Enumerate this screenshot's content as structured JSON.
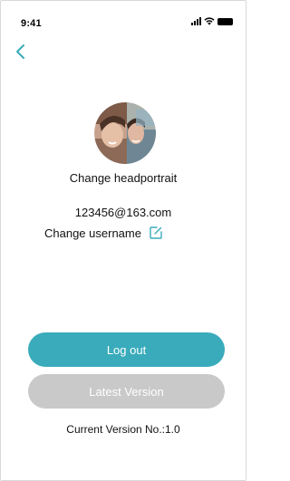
{
  "status_bar": {
    "time": "9:41",
    "icons": [
      "signal-icon",
      "wifi-icon",
      "battery-icon"
    ]
  },
  "nav": {
    "back_icon": "chevron-left-icon"
  },
  "profile": {
    "avatar_icon": "avatar-photo",
    "change_headportrait_label": "Change headportrait",
    "email": "123456@163.com",
    "change_username_label": "Change username",
    "edit_icon": "edit-icon"
  },
  "actions": {
    "logout_label": "Log out",
    "latest_version_label": "Latest Version"
  },
  "footer": {
    "current_version": "Current Version No.:1.0"
  },
  "colors": {
    "accent": "#3aabbb",
    "disabled": "#c9c9c9",
    "text": "#111111",
    "background": "#ffffff"
  }
}
